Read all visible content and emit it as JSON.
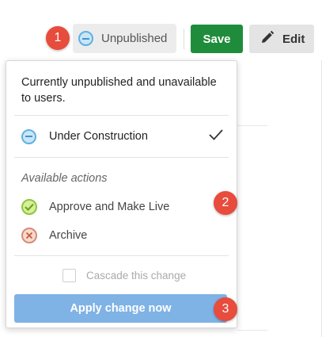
{
  "toolbar": {
    "status_label": "Unpublished",
    "save_label": "Save",
    "edit_label": "Edit"
  },
  "markers": [
    "1",
    "2",
    "3"
  ],
  "dropdown": {
    "description": "Currently unpublished and unavailable to users.",
    "current_state": "Under Construction",
    "actions_title": "Available actions",
    "actions": [
      {
        "label": "Approve and Make Live",
        "icon": "approve-check-icon"
      },
      {
        "label": "Archive",
        "icon": "archive-x-icon"
      }
    ],
    "cascade_label": "Cascade this change",
    "cascade_checked": false,
    "apply_label": "Apply change now"
  },
  "colors": {
    "save": "#1f8c3b",
    "apply": "#7fb2e5",
    "marker": "#e74c3c",
    "status_icon": "#5fb0e3"
  }
}
